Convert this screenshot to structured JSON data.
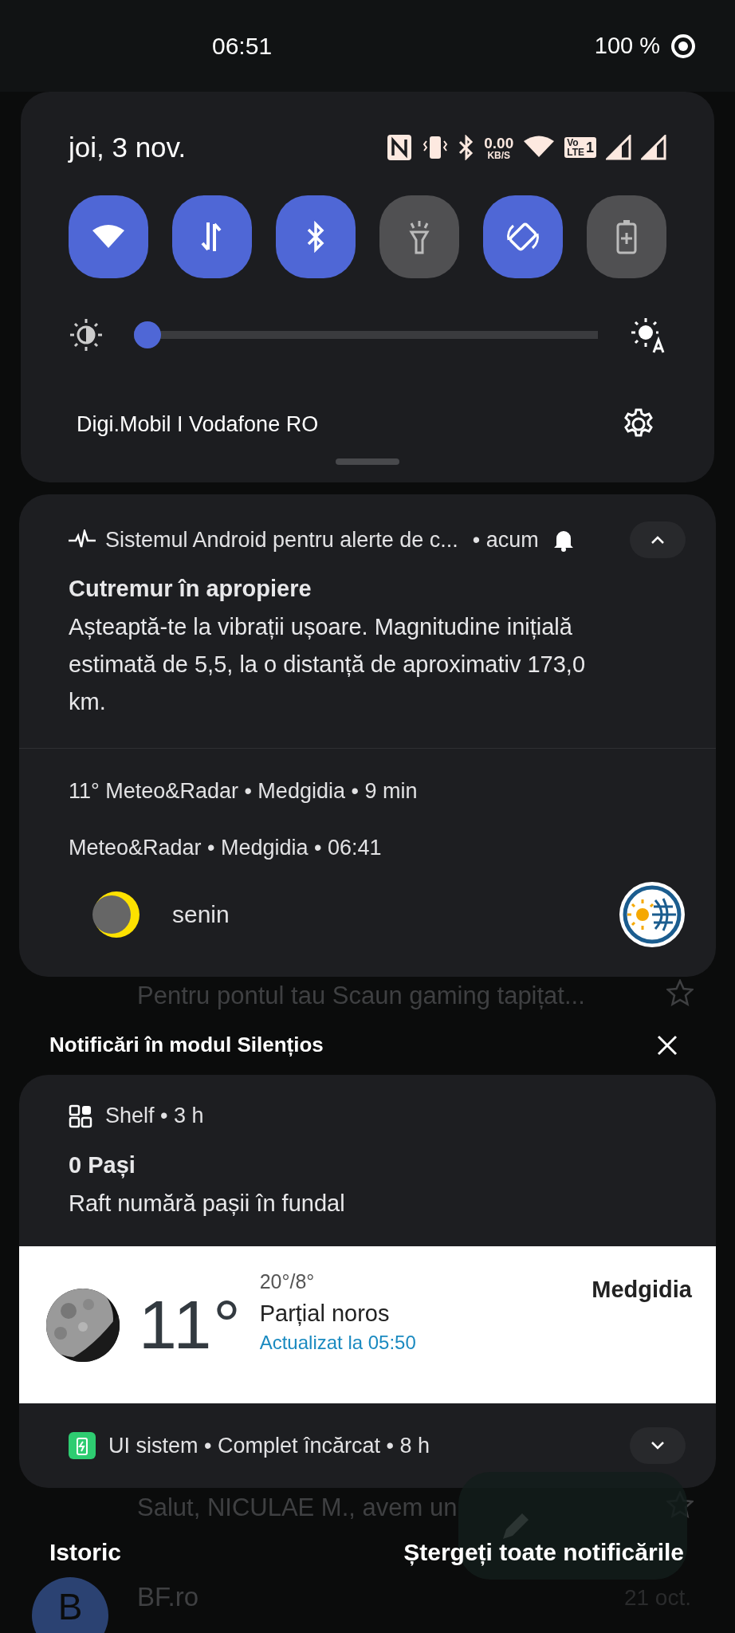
{
  "status_bar": {
    "time": "06:51",
    "battery": "100 %"
  },
  "quick_settings": {
    "date": "joi, 3 nov.",
    "net_speed": {
      "value": "0.00",
      "unit": "KB/S"
    },
    "volte": {
      "top": "Vo",
      "bottom": "LTE",
      "sim": "1"
    },
    "tiles": [
      {
        "kind": "wifi",
        "on": true
      },
      {
        "kind": "data",
        "on": true
      },
      {
        "kind": "bluetooth",
        "on": true
      },
      {
        "kind": "flashlight",
        "on": false
      },
      {
        "kind": "rotate",
        "on": true
      },
      {
        "kind": "battery-saver",
        "on": false
      }
    ],
    "brightness": {
      "level": 0.0
    },
    "carrier": "Digi.Mobil I Vodafone RO"
  },
  "alert": {
    "app": "Sistemul Android pentru alerte de c...",
    "time": "• acum",
    "expanded": true,
    "title": "Cutremur în apropiere",
    "body": "Așteaptă-te la vibrații ușoare. Magnitudine inițială estimată de 5,5, la o distanță de aproximativ 173,0 km."
  },
  "meteo": {
    "summary": "11°  Meteo&Radar • Medgidia • 9 min",
    "header": "Meteo&Radar • Medgidia • 06:41",
    "condition": "senin"
  },
  "background_rows": [
    {
      "text": "Pentru pontul tau Scaun gaming tapițat..."
    },
    {
      "text": "Salut, NICULAE M., avem un"
    }
  ],
  "silent_header": "Notificări în modul Silențios",
  "shelf": {
    "header": "Shelf • 3 h",
    "title": "0 Pași",
    "body": "Raft numără pașii în fundal"
  },
  "weather_widget": {
    "temp": "11°",
    "range": "20°/8°",
    "condition": "Parțial noros",
    "updated": "Actualizat la 05:50",
    "location": "Medgidia"
  },
  "system_ui": {
    "header": "UI sistem • Complet încărcat • 8 h",
    "expanded": false
  },
  "footer": {
    "history": "Istoric",
    "clear_all": "Ștergeți toate notificările"
  },
  "background_mail": {
    "avatar": "B",
    "sender": "BF.ro",
    "date": "21 oct."
  }
}
